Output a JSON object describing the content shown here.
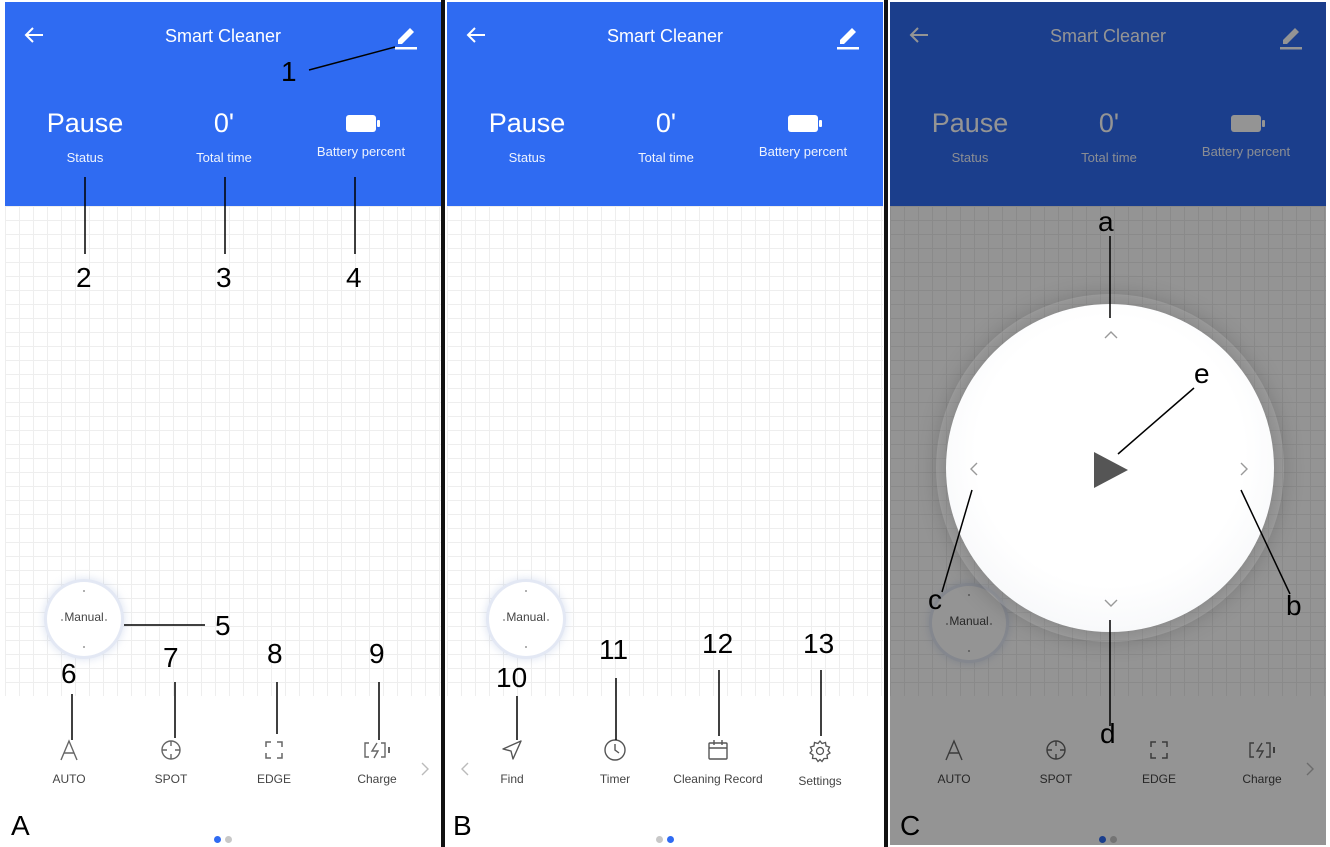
{
  "colors": {
    "header_blue": "#2f6bf2",
    "accent_dot": "#2f6bf2",
    "overlay": "#00000069"
  },
  "header": {
    "title": "Smart Cleaner",
    "back_icon": "back-arrow-icon",
    "edit_icon": "pencil-icon"
  },
  "status": {
    "status_value": "Pause",
    "status_label": "Status",
    "time_value": "0'",
    "time_label": "Total time",
    "battery_icon": "battery-icon",
    "battery_label": "Battery percent"
  },
  "manual_button": {
    "label": "Manual"
  },
  "page1_tools": [
    {
      "label": "AUTO",
      "icon": "auto-a-icon"
    },
    {
      "label": "SPOT",
      "icon": "spot-crosshair-icon"
    },
    {
      "label": "EDGE",
      "icon": "edge-corners-icon"
    },
    {
      "label": "Charge",
      "icon": "charge-bolt-icon"
    }
  ],
  "page2_tools": [
    {
      "label": "Find",
      "icon": "find-navigation-icon"
    },
    {
      "label": "Timer",
      "icon": "clock-icon"
    },
    {
      "label": "Cleaning Record",
      "icon": "calendar-icon"
    },
    {
      "label": "Settings",
      "icon": "gear-icon"
    }
  ],
  "panels": [
    {
      "letter": "A",
      "page_indicator": [
        true,
        false
      ]
    },
    {
      "letter": "B",
      "page_indicator": [
        false,
        true
      ]
    },
    {
      "letter": "C",
      "page_indicator": [
        true,
        false
      ]
    }
  ],
  "callouts_a": [
    "1",
    "2",
    "3",
    "4",
    "5",
    "6",
    "7",
    "8",
    "9"
  ],
  "callouts_b": [
    "10",
    "11",
    "12",
    "13"
  ],
  "callouts_c": [
    "a",
    "b",
    "c",
    "d",
    "e"
  ],
  "joystick": {
    "center_icon": "play-icon",
    "up": "chevron-up-icon",
    "down": "chevron-down-icon",
    "left": "chevron-left-icon",
    "right": "chevron-right-icon"
  }
}
